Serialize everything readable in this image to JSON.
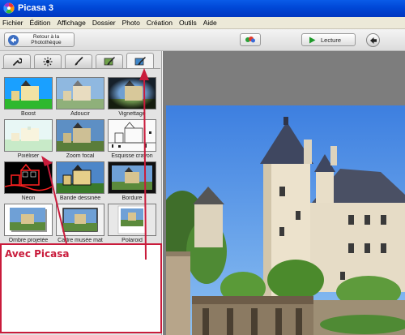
{
  "window": {
    "title": "Picasa 3"
  },
  "menu": [
    "Fichier",
    "Édition",
    "Affichage",
    "Dossier",
    "Photo",
    "Création",
    "Outils",
    "Aide"
  ],
  "toolbar": {
    "back_label_line1": "Retour à la",
    "back_label_line2": "Photothèque",
    "play_label": "Lecture"
  },
  "tabs": [
    {
      "icon": "wrench-icon"
    },
    {
      "icon": "sun-icon"
    },
    {
      "icon": "brush-icon"
    },
    {
      "icon": "brush-icon"
    },
    {
      "icon": "brush-icon",
      "active": true
    }
  ],
  "effects": [
    {
      "label": "Boost"
    },
    {
      "label": "Adoucir"
    },
    {
      "label": "Vignettage"
    },
    {
      "label": "Pixéliser"
    },
    {
      "label": "Zoom focal"
    },
    {
      "label": "Esquisse crayon"
    },
    {
      "label": "Néon"
    },
    {
      "label": "Bande dessinée"
    },
    {
      "label": "Bordure"
    },
    {
      "label": "Ombre projetée"
    },
    {
      "label": "Cadre musée mat"
    },
    {
      "label": "Polaroid"
    }
  ],
  "annotation": {
    "text": "Avec Picasa",
    "color": "#c91b3b"
  },
  "colors": {
    "titlebar": "#0047d6",
    "accent": "#c91b3b",
    "viewer_bg": "#7d7d7d"
  }
}
